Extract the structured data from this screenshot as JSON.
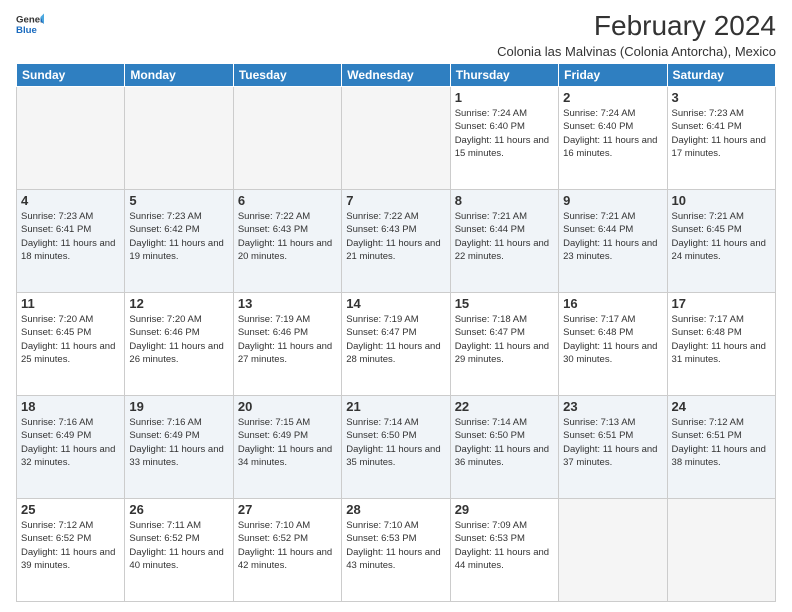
{
  "header": {
    "logo_general": "General",
    "logo_blue": "Blue",
    "title": "February 2024",
    "subtitle": "Colonia las Malvinas (Colonia Antorcha), Mexico"
  },
  "days_of_week": [
    "Sunday",
    "Monday",
    "Tuesday",
    "Wednesday",
    "Thursday",
    "Friday",
    "Saturday"
  ],
  "weeks": [
    [
      {
        "day": "",
        "info": ""
      },
      {
        "day": "",
        "info": ""
      },
      {
        "day": "",
        "info": ""
      },
      {
        "day": "",
        "info": ""
      },
      {
        "day": "1",
        "info": "Sunrise: 7:24 AM\nSunset: 6:40 PM\nDaylight: 11 hours and 15 minutes."
      },
      {
        "day": "2",
        "info": "Sunrise: 7:24 AM\nSunset: 6:40 PM\nDaylight: 11 hours and 16 minutes."
      },
      {
        "day": "3",
        "info": "Sunrise: 7:23 AM\nSunset: 6:41 PM\nDaylight: 11 hours and 17 minutes."
      }
    ],
    [
      {
        "day": "4",
        "info": "Sunrise: 7:23 AM\nSunset: 6:41 PM\nDaylight: 11 hours and 18 minutes."
      },
      {
        "day": "5",
        "info": "Sunrise: 7:23 AM\nSunset: 6:42 PM\nDaylight: 11 hours and 19 minutes."
      },
      {
        "day": "6",
        "info": "Sunrise: 7:22 AM\nSunset: 6:43 PM\nDaylight: 11 hours and 20 minutes."
      },
      {
        "day": "7",
        "info": "Sunrise: 7:22 AM\nSunset: 6:43 PM\nDaylight: 11 hours and 21 minutes."
      },
      {
        "day": "8",
        "info": "Sunrise: 7:21 AM\nSunset: 6:44 PM\nDaylight: 11 hours and 22 minutes."
      },
      {
        "day": "9",
        "info": "Sunrise: 7:21 AM\nSunset: 6:44 PM\nDaylight: 11 hours and 23 minutes."
      },
      {
        "day": "10",
        "info": "Sunrise: 7:21 AM\nSunset: 6:45 PM\nDaylight: 11 hours and 24 minutes."
      }
    ],
    [
      {
        "day": "11",
        "info": "Sunrise: 7:20 AM\nSunset: 6:45 PM\nDaylight: 11 hours and 25 minutes."
      },
      {
        "day": "12",
        "info": "Sunrise: 7:20 AM\nSunset: 6:46 PM\nDaylight: 11 hours and 26 minutes."
      },
      {
        "day": "13",
        "info": "Sunrise: 7:19 AM\nSunset: 6:46 PM\nDaylight: 11 hours and 27 minutes."
      },
      {
        "day": "14",
        "info": "Sunrise: 7:19 AM\nSunset: 6:47 PM\nDaylight: 11 hours and 28 minutes."
      },
      {
        "day": "15",
        "info": "Sunrise: 7:18 AM\nSunset: 6:47 PM\nDaylight: 11 hours and 29 minutes."
      },
      {
        "day": "16",
        "info": "Sunrise: 7:17 AM\nSunset: 6:48 PM\nDaylight: 11 hours and 30 minutes."
      },
      {
        "day": "17",
        "info": "Sunrise: 7:17 AM\nSunset: 6:48 PM\nDaylight: 11 hours and 31 minutes."
      }
    ],
    [
      {
        "day": "18",
        "info": "Sunrise: 7:16 AM\nSunset: 6:49 PM\nDaylight: 11 hours and 32 minutes."
      },
      {
        "day": "19",
        "info": "Sunrise: 7:16 AM\nSunset: 6:49 PM\nDaylight: 11 hours and 33 minutes."
      },
      {
        "day": "20",
        "info": "Sunrise: 7:15 AM\nSunset: 6:49 PM\nDaylight: 11 hours and 34 minutes."
      },
      {
        "day": "21",
        "info": "Sunrise: 7:14 AM\nSunset: 6:50 PM\nDaylight: 11 hours and 35 minutes."
      },
      {
        "day": "22",
        "info": "Sunrise: 7:14 AM\nSunset: 6:50 PM\nDaylight: 11 hours and 36 minutes."
      },
      {
        "day": "23",
        "info": "Sunrise: 7:13 AM\nSunset: 6:51 PM\nDaylight: 11 hours and 37 minutes."
      },
      {
        "day": "24",
        "info": "Sunrise: 7:12 AM\nSunset: 6:51 PM\nDaylight: 11 hours and 38 minutes."
      }
    ],
    [
      {
        "day": "25",
        "info": "Sunrise: 7:12 AM\nSunset: 6:52 PM\nDaylight: 11 hours and 39 minutes."
      },
      {
        "day": "26",
        "info": "Sunrise: 7:11 AM\nSunset: 6:52 PM\nDaylight: 11 hours and 40 minutes."
      },
      {
        "day": "27",
        "info": "Sunrise: 7:10 AM\nSunset: 6:52 PM\nDaylight: 11 hours and 42 minutes."
      },
      {
        "day": "28",
        "info": "Sunrise: 7:10 AM\nSunset: 6:53 PM\nDaylight: 11 hours and 43 minutes."
      },
      {
        "day": "29",
        "info": "Sunrise: 7:09 AM\nSunset: 6:53 PM\nDaylight: 11 hours and 44 minutes."
      },
      {
        "day": "",
        "info": ""
      },
      {
        "day": "",
        "info": ""
      }
    ]
  ]
}
